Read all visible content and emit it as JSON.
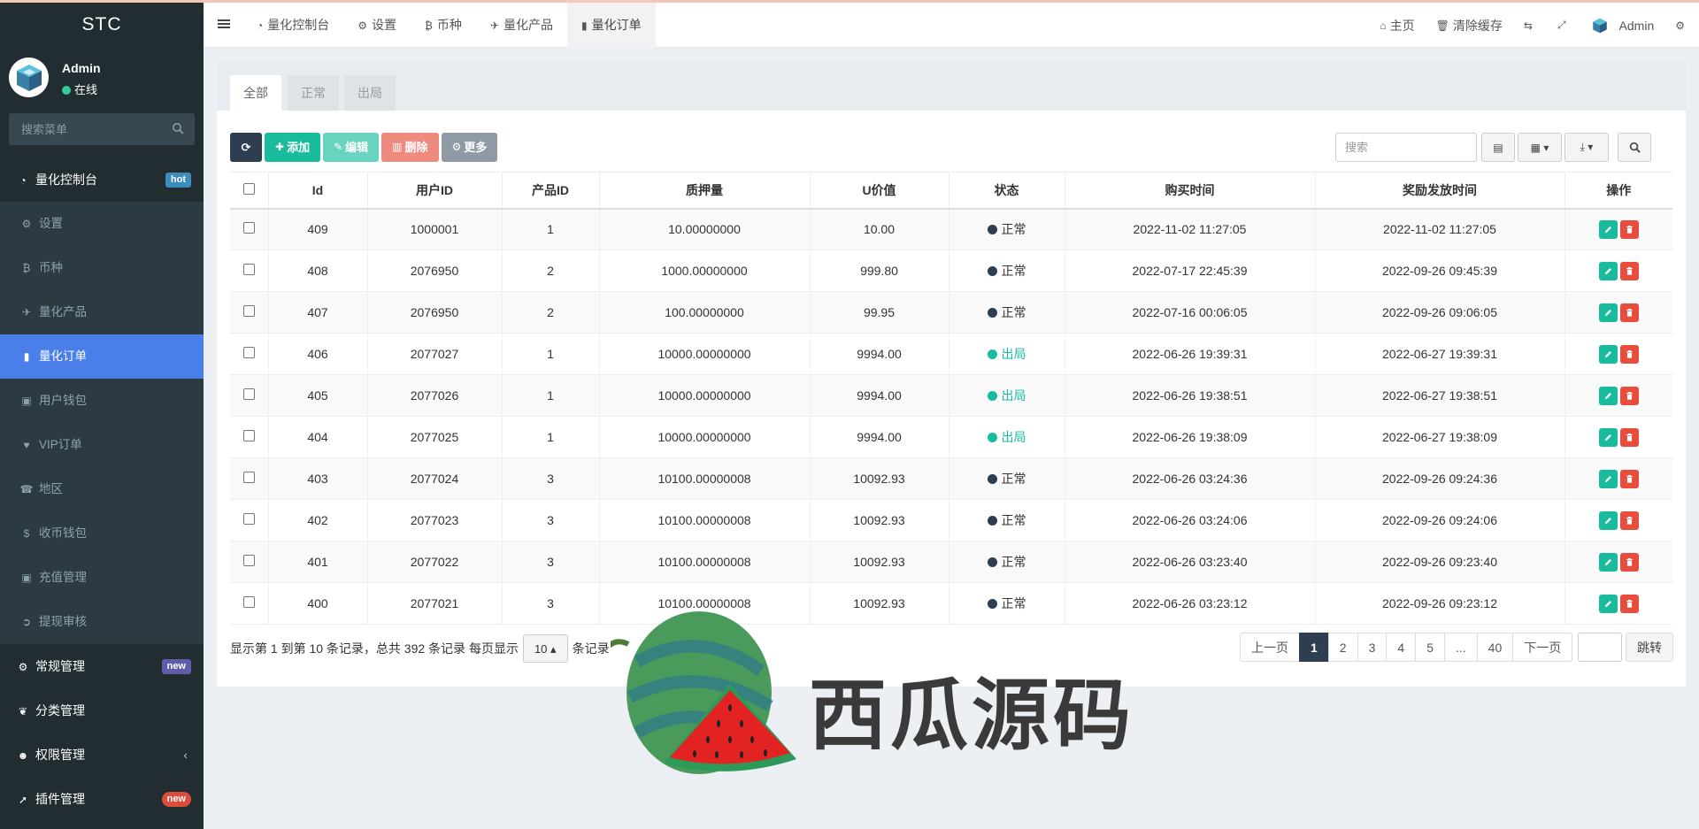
{
  "brand": "STC",
  "user": {
    "name": "Admin",
    "status": "在线"
  },
  "sidebar": {
    "search_placeholder": "搜索菜单",
    "items": [
      {
        "label": "量化控制台",
        "badge": "hot"
      },
      {
        "label": "设置"
      },
      {
        "label": "币种"
      },
      {
        "label": "量化产品"
      },
      {
        "label": "量化订单"
      },
      {
        "label": "用户钱包"
      },
      {
        "label": "VIP订单"
      },
      {
        "label": "地区"
      },
      {
        "label": "收币钱包"
      },
      {
        "label": "充值管理"
      },
      {
        "label": "提现审核"
      },
      {
        "label": "常规管理",
        "badge": "new"
      },
      {
        "label": "分类管理"
      },
      {
        "label": "权限管理"
      },
      {
        "label": "插件管理",
        "badge": "new"
      }
    ]
  },
  "header": {
    "tabs": [
      "量化控制台",
      "设置",
      "币种",
      "量化产品",
      "量化订单"
    ],
    "home": "主页",
    "clear_cache": "清除缓存",
    "admin": "Admin"
  },
  "filter_tabs": [
    "全部",
    "正常",
    "出局"
  ],
  "toolbar": {
    "add": "添加",
    "edit": "编辑",
    "delete": "删除",
    "more": "更多",
    "search_placeholder": "搜索"
  },
  "table": {
    "columns": [
      "Id",
      "用户ID",
      "产品ID",
      "质押量",
      "U价值",
      "状态",
      "购买时间",
      "奖励发放时间",
      "操作"
    ],
    "rows": [
      [
        "409",
        "1000001",
        "1",
        "10.00000000",
        "10.00",
        "正常",
        "2022-11-02 11:27:05",
        "2022-11-02 11:27:05"
      ],
      [
        "408",
        "2076950",
        "2",
        "1000.00000000",
        "999.80",
        "正常",
        "2022-07-17 22:45:39",
        "2022-09-26 09:45:39"
      ],
      [
        "407",
        "2076950",
        "2",
        "100.00000000",
        "99.95",
        "正常",
        "2022-07-16 00:06:05",
        "2022-09-26 09:06:05"
      ],
      [
        "406",
        "2077027",
        "1",
        "10000.00000000",
        "9994.00",
        "出局",
        "2022-06-26 19:39:31",
        "2022-06-27 19:39:31"
      ],
      [
        "405",
        "2077026",
        "1",
        "10000.00000000",
        "9994.00",
        "出局",
        "2022-06-26 19:38:51",
        "2022-06-27 19:38:51"
      ],
      [
        "404",
        "2077025",
        "1",
        "10000.00000000",
        "9994.00",
        "出局",
        "2022-06-26 19:38:09",
        "2022-06-27 19:38:09"
      ],
      [
        "403",
        "2077024",
        "3",
        "10100.00000008",
        "10092.93",
        "正常",
        "2022-06-26 03:24:36",
        "2022-09-26 09:24:36"
      ],
      [
        "402",
        "2077023",
        "3",
        "10100.00000008",
        "10092.93",
        "正常",
        "2022-06-26 03:24:06",
        "2022-09-26 09:24:06"
      ],
      [
        "401",
        "2077022",
        "3",
        "10100.00000008",
        "10092.93",
        "正常",
        "2022-06-26 03:23:40",
        "2022-09-26 09:23:40"
      ],
      [
        "400",
        "2077021",
        "3",
        "10100.00000008",
        "10092.93",
        "正常",
        "2022-06-26 03:23:12",
        "2022-09-26 09:23:12"
      ]
    ]
  },
  "footer": {
    "info_prefix": "显示第 1 到第 10 条记录，总共 392 条记录 每页显示",
    "page_size": "10",
    "info_suffix": "条记录",
    "pager": [
      "上一页",
      "1",
      "2",
      "3",
      "4",
      "5",
      "...",
      "40",
      "下一页"
    ],
    "current": "1",
    "go": "跳转"
  },
  "watermark": "西瓜源码"
}
